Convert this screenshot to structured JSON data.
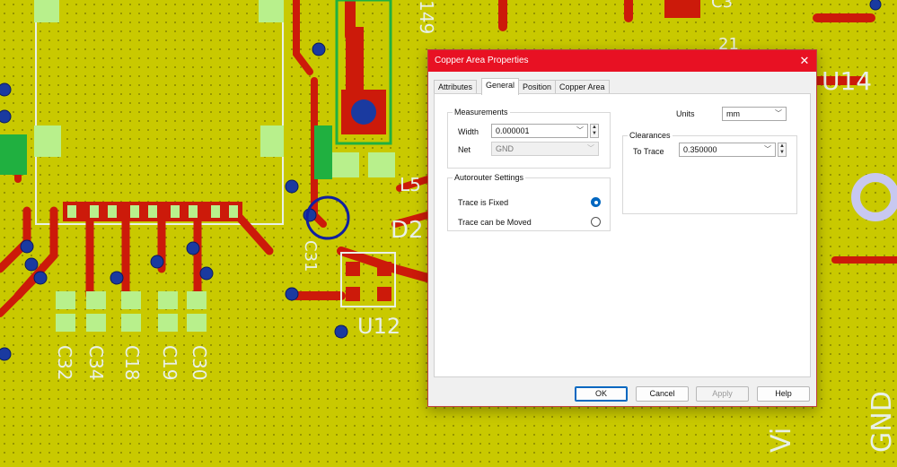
{
  "pcb": {
    "silkscreen_labels": [
      "C32",
      "C34",
      "C18",
      "C19",
      "C30",
      "U12",
      "D2",
      "L5",
      "U14",
      "GND",
      "149",
      "C3",
      "C31",
      "21",
      "Vi"
    ],
    "colors": {
      "board": "#c9c900",
      "copper": "#cc1a0a",
      "silkscreen": "#e8f0e8",
      "via": "#1a3aa0",
      "pad": "#b8f08c",
      "select_circle": "#1020a0"
    }
  },
  "dialog": {
    "title": "Copper Area Properties",
    "close_icon": "close-icon",
    "tabs": [
      {
        "label": "Attributes",
        "active": false
      },
      {
        "label": "General",
        "active": true
      },
      {
        "label": "Position",
        "active": false
      },
      {
        "label": "Copper Area",
        "active": false
      }
    ],
    "measurements": {
      "group_title": "Measurements",
      "width_label": "Width",
      "width_value": "0.000001",
      "net_label": "Net",
      "net_value": "GND"
    },
    "units": {
      "label": "Units",
      "value": "mm"
    },
    "clearances": {
      "group_title": "Clearances",
      "to_trace_label": "To Trace",
      "to_trace_value": "0.350000"
    },
    "autorouter": {
      "group_title": "Autorouter Settings",
      "options": [
        {
          "label": "Trace is Fixed",
          "checked": true
        },
        {
          "label": "Trace can be Moved",
          "checked": false
        }
      ]
    },
    "buttons": {
      "ok": "OK",
      "cancel": "Cancel",
      "apply": "Apply",
      "help": "Help"
    }
  }
}
